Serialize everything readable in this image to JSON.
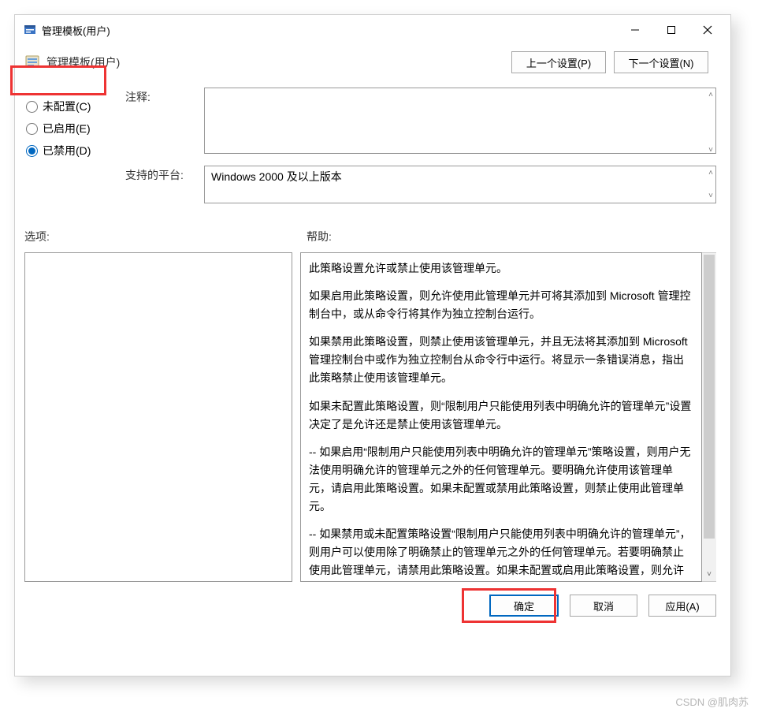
{
  "window": {
    "title": "管理模板(用户)"
  },
  "header": {
    "caption": "管理模板(用户)",
    "prev_btn": "上一个设置(P)",
    "next_btn": "下一个设置(N)"
  },
  "radios": {
    "not_configured": "未配置(C)",
    "enabled": "已启用(E)",
    "disabled": "已禁用(D)"
  },
  "labels": {
    "comment": "注释:",
    "platform": "支持的平台:",
    "options": "选项:",
    "help": "帮助:"
  },
  "values": {
    "comment": "",
    "platform": "Windows 2000 及以上版本"
  },
  "help": {
    "p1": "此策略设置允许或禁止使用该管理单元。",
    "p2": "如果启用此策略设置，则允许使用此管理单元并可将其添加到 Microsoft 管理控制台中，或从命令行将其作为独立控制台运行。",
    "p3": "如果禁用此策略设置，则禁止使用该管理单元，并且无法将其添加到 Microsoft 管理控制台中或作为独立控制台从命令行中运行。将显示一条错误消息，指出此策略禁止使用该管理单元。",
    "p4": "如果未配置此策略设置，则“限制用户只能使用列表中明确允许的管理单元”设置决定了是允许还是禁止使用该管理单元。",
    "p5": "--  如果启用“限制用户只能使用列表中明确允许的管理单元”策略设置，则用户无法使用明确允许的管理单元之外的任何管理单元。要明确允许使用该管理单元，请启用此策略设置。如果未配置或禁用此策略设置，则禁止使用此管理单元。",
    "p6": "--  如果禁用或未配置策略设置“限制用户只能使用列表中明确允许的管理单元”，则用户可以使用除了明确禁止的管理单元之外的任何管理单元。若要明确禁止使用此管理单元，请禁用此策略设置。如果未配置或启用此策略设置，则允许使用该管理单元。"
  },
  "footer": {
    "ok": "确定",
    "cancel": "取消",
    "apply": "应用(A)"
  },
  "watermark": "CSDN @肌肉苏"
}
